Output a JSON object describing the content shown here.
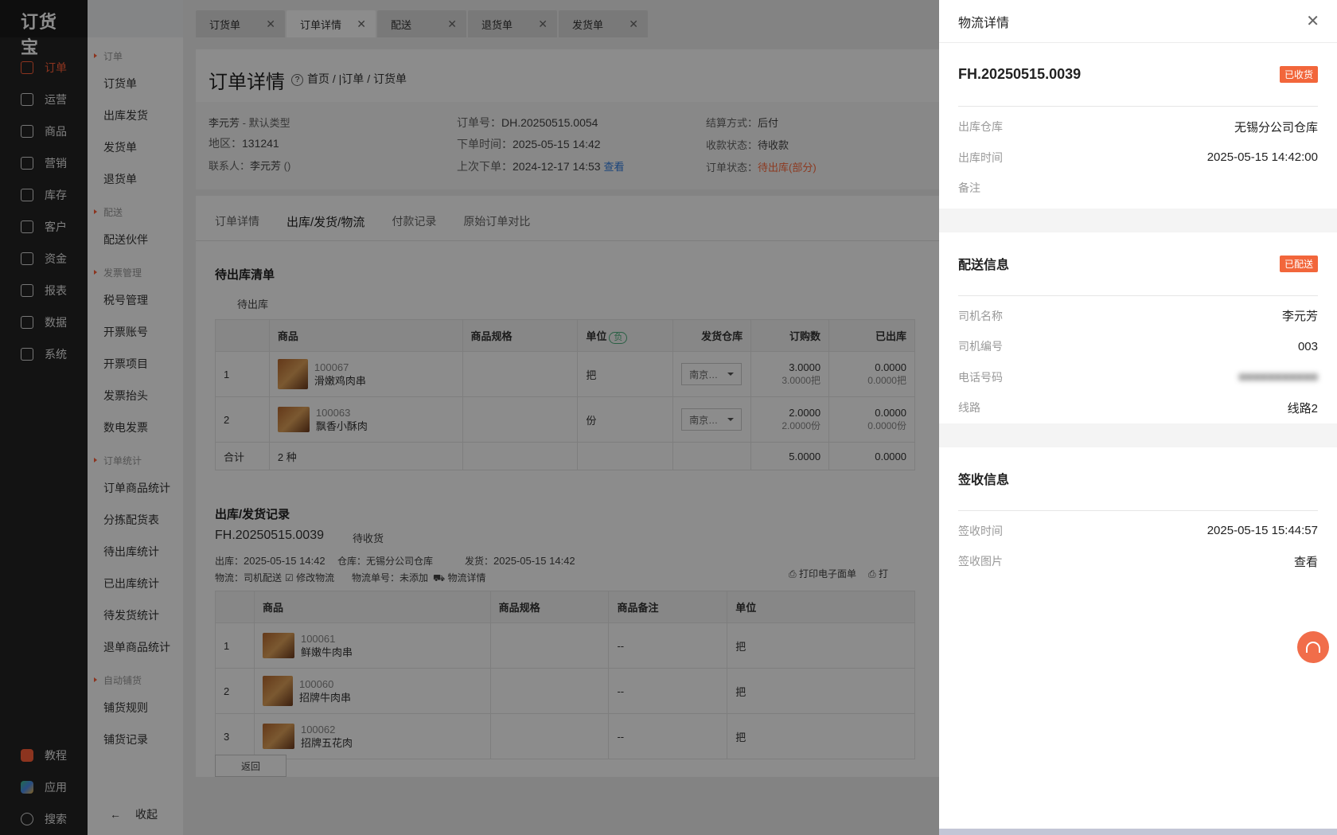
{
  "app": {
    "logo": "订货宝"
  },
  "nav": {
    "items": [
      {
        "label": "订单",
        "icon": "order-icon"
      },
      {
        "label": "运营",
        "icon": "operation-icon"
      },
      {
        "label": "商品",
        "icon": "product-icon"
      },
      {
        "label": "营销",
        "icon": "marketing-icon"
      },
      {
        "label": "库存",
        "icon": "inventory-icon"
      },
      {
        "label": "客户",
        "icon": "customer-icon"
      },
      {
        "label": "资金",
        "icon": "funds-icon"
      },
      {
        "label": "报表",
        "icon": "report-icon"
      },
      {
        "label": "数据",
        "icon": "data-icon"
      },
      {
        "label": "系统",
        "icon": "system-icon"
      }
    ],
    "bottom": [
      {
        "label": "教程",
        "icon": "tutorial-icon"
      },
      {
        "label": "应用",
        "icon": "apps-icon"
      },
      {
        "label": "搜索",
        "icon": "search-icon"
      }
    ]
  },
  "submenu": {
    "groups": [
      {
        "title": "订单",
        "items": [
          "订货单",
          "出库发货",
          "发货单",
          "退货单"
        ]
      },
      {
        "title": "配送",
        "items": [
          "配送伙伴"
        ]
      },
      {
        "title": "发票管理",
        "items": [
          "税号管理",
          "开票账号",
          "开票项目",
          "发票抬头",
          "数电发票"
        ]
      },
      {
        "title": "订单统计",
        "items": [
          "订单商品统计",
          "分拣配货表",
          "待出库统计",
          "已出库统计",
          "待发货统计",
          "退单商品统计"
        ]
      },
      {
        "title": "自动铺货",
        "items": [
          "铺货规则",
          "铺货记录"
        ]
      }
    ],
    "collapse_label": "收起",
    "collapse_arrow": "←"
  },
  "tabs": [
    "订货单",
    "订单详情",
    "配送",
    "退货单",
    "发货单"
  ],
  "header": {
    "title": "订单详情",
    "breadcrumb": "首页 / |订单 / 订货单",
    "customer": "李元芳",
    "customer_type": " - 默认类型",
    "region_label": "地区：",
    "region": "131241",
    "contact_label": "联系人：",
    "contact": "李元芳",
    "contact_extra": "()",
    "order_no_label": "订单号：",
    "order_no": "DH.20250515.0054",
    "order_time_label": "下单时间：",
    "order_time": "2025-05-15 14:42",
    "last_order_label": "上次下单：",
    "last_order": "2024-12-17 14:53",
    "view_link": "查看",
    "settle_label": "结算方式：",
    "settle": "后付",
    "pay_status_label": "收款状态：",
    "pay_status": "待收款",
    "order_status_label": "订单状态：",
    "order_status": "待出库(部分)"
  },
  "subtabs": [
    "订单详情",
    "出库/发货/物流",
    "付款记录",
    "原始订单对比"
  ],
  "pending": {
    "title": "待出库清单",
    "sub_label": "待出库",
    "columns": [
      "",
      "商品",
      "商品规格",
      "单位",
      "发货仓库",
      "订购数",
      "已出库"
    ],
    "unit_badge": "负",
    "rows": [
      {
        "idx": "1",
        "code": "100067",
        "name": "滑嫩鸡肉串",
        "spec": "",
        "unit": "把",
        "warehouse": "南京…",
        "ordered": "3.0000",
        "ordered_sub": "3.0000把",
        "out": "0.0000",
        "out_sub": "0.0000把"
      },
      {
        "idx": "2",
        "code": "100063",
        "name": "飘香小酥肉",
        "spec": "",
        "unit": "份",
        "warehouse": "南京…",
        "ordered": "2.0000",
        "ordered_sub": "2.0000份",
        "out": "0.0000",
        "out_sub": "0.0000份"
      }
    ],
    "total": {
      "label": "合计",
      "kinds": "2 种",
      "ordered": "5.0000",
      "out": "0.0000"
    }
  },
  "record": {
    "title": "出库/发货记录",
    "no": "FH.20250515.0039",
    "status": "待收货",
    "out_label": "出库：",
    "out_time": "2025-05-15 14:42",
    "wh_label": "仓库：",
    "warehouse": "无锡分公司仓库",
    "ship_label": "发货：",
    "ship_time": "2025-05-15 14:42",
    "logistics_label": "物流：",
    "logistics": "司机配送",
    "edit_logistics": "修改物流",
    "tracking_label": "物流单号：",
    "tracking": "未添加",
    "logistics_detail": "物流详情",
    "print_label": "打印电子面单",
    "print2_label": "打",
    "columns": [
      "",
      "商品",
      "商品规格",
      "商品备注",
      "单位"
    ],
    "rows": [
      {
        "idx": "1",
        "code": "100061",
        "name": "鲜嫩牛肉串",
        "spec": "",
        "remark": "--",
        "unit": "把"
      },
      {
        "idx": "2",
        "code": "100060",
        "name": "招牌牛肉串",
        "spec": "",
        "remark": "--",
        "unit": "把"
      },
      {
        "idx": "3",
        "code": "100062",
        "name": "招牌五花肉",
        "spec": "",
        "remark": "--",
        "unit": "把"
      }
    ],
    "return_btn": "返回"
  },
  "drawer": {
    "title": "物流详情",
    "shipment_no": "FH.20250515.0039",
    "shipment_status": "已收货",
    "warehouse_label": "出库仓库",
    "warehouse": "无锡分公司仓库",
    "out_time_label": "出库时间",
    "out_time": "2025-05-15 14:42:00",
    "remark_label": "备注",
    "remark": "",
    "delivery_title": "配送信息",
    "delivery_status": "已配送",
    "driver_name_label": "司机名称",
    "driver_name": "李元芳",
    "driver_no_label": "司机编号",
    "driver_no": "003",
    "phone_label": "电话号码",
    "route_label": "线路",
    "route": "线路2",
    "sign_title": "签收信息",
    "sign_time_label": "签收时间",
    "sign_time": "2025-05-15 15:44:57",
    "sign_img_label": "签收图片",
    "sign_img_link": "查看"
  },
  "colors": {
    "accent": "#ff5f39",
    "link": "#2f7ce0",
    "badge": "#f2663b"
  }
}
